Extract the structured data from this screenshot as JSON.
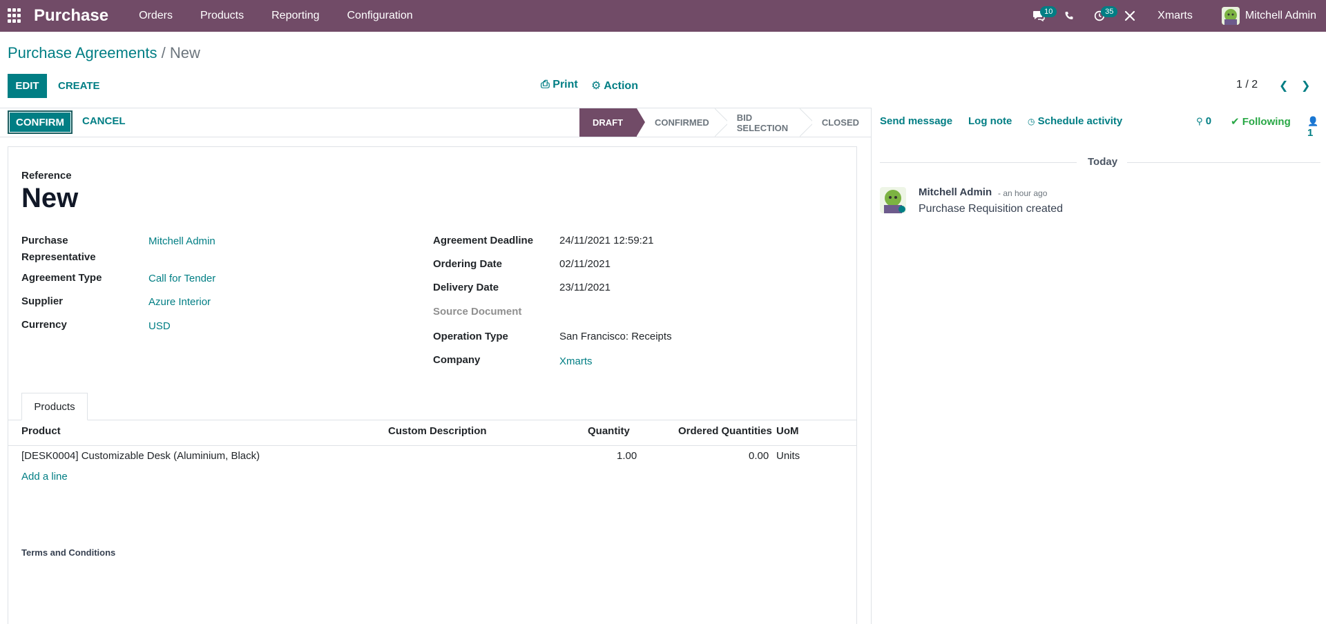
{
  "navbar": {
    "brand": "Purchase",
    "menu": [
      "Orders",
      "Products",
      "Reporting",
      "Configuration"
    ],
    "messages_count": "10",
    "activities_count": "35",
    "company": "Xmarts",
    "user": "Mitchell Admin",
    "bg_color": "#714b67"
  },
  "breadcrumb": {
    "parent": "Purchase Agreements",
    "separator": "/",
    "current": "New"
  },
  "controls": {
    "edit": "EDIT",
    "create": "CREATE",
    "print": "Print",
    "action": "Action",
    "pager": "1 / 2"
  },
  "statusbar": {
    "confirm": "CONFIRM",
    "cancel": "CANCEL",
    "stages": [
      "DRAFT",
      "CONFIRMED",
      "BID SELECTION",
      "CLOSED"
    ],
    "active_stage": "DRAFT"
  },
  "form": {
    "reference_label": "Reference",
    "reference_value": "New",
    "left": [
      {
        "label": "Purchase Representative",
        "value": "Mitchell Admin"
      },
      {
        "label": "Agreement Type",
        "value": "Call for Tender"
      },
      {
        "label": "Supplier",
        "value": "Azure Interior"
      },
      {
        "label": "Currency",
        "value": "USD"
      }
    ],
    "right": [
      {
        "label": "Agreement Deadline",
        "value": "24/11/2021 12:59:21"
      },
      {
        "label": "Ordering Date",
        "value": "02/11/2021"
      },
      {
        "label": "Delivery Date",
        "value": "23/11/2021"
      },
      {
        "label": "Source Document",
        "value": ""
      },
      {
        "label": "Operation Type",
        "value": "San Francisco: Receipts"
      },
      {
        "label": "Company",
        "value": "Xmarts"
      }
    ],
    "tab": "Products",
    "table": {
      "headers": [
        "Product",
        "Custom Description",
        "Quantity",
        "Ordered Quantities",
        "UoM"
      ],
      "rows": [
        [
          "[DESK0004] Customizable Desk (Aluminium, Black)",
          "",
          "1.00",
          "0.00",
          "Units"
        ]
      ]
    },
    "add_line": "Add a line",
    "terms": "Terms and Conditions"
  },
  "chatter": {
    "send_message": "Send message",
    "log_note": "Log note",
    "schedule_activity": "Schedule activity",
    "attachments": "0",
    "following": "Following",
    "followers": "1",
    "today": "Today",
    "message": {
      "author": "Mitchell Admin",
      "date": "- an hour ago",
      "body": "Purchase Requisition created"
    }
  },
  "colors": {
    "accent": "#017e84",
    "brand": "#714b67",
    "following": "#28a745"
  }
}
